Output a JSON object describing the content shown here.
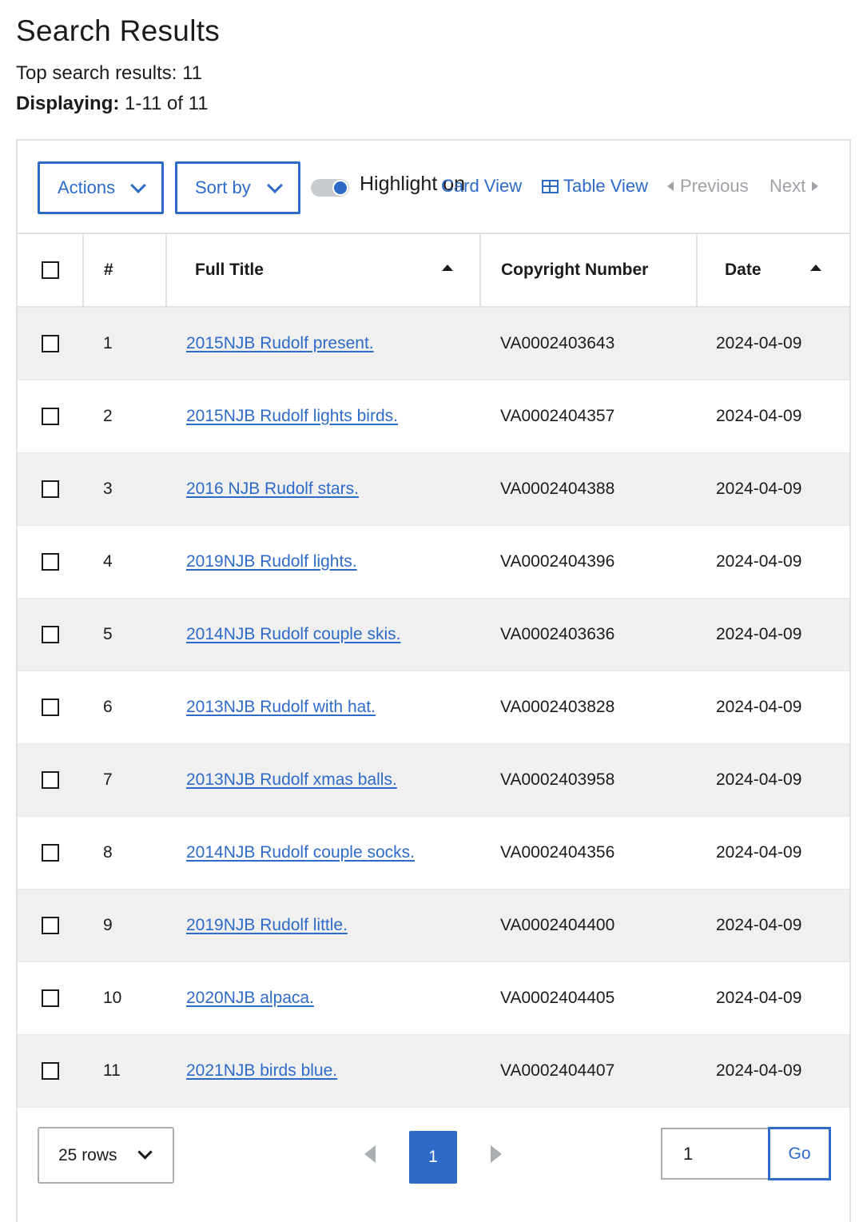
{
  "header": {
    "title": "Search Results",
    "top_results_label": "Top search results: 11",
    "displaying_label": "Displaying:",
    "displaying_value": "1-11 of 11"
  },
  "toolbar": {
    "actions_label": "Actions",
    "sort_label": "Sort by",
    "highlight_label": "Highlight on",
    "card_view_label": "Card View",
    "table_view_label": "Table View",
    "previous_label": "Previous",
    "next_label": "Next"
  },
  "table": {
    "headers": {
      "num": "#",
      "title": "Full Title",
      "copyright": "Copyright Number",
      "date": "Date"
    },
    "rows": [
      {
        "num": "1",
        "title": "2015NJB Rudolf present.",
        "copyright": "VA0002403643",
        "date": "2024-04-09"
      },
      {
        "num": "2",
        "title": "2015NJB Rudolf lights birds.",
        "copyright": "VA0002404357",
        "date": "2024-04-09"
      },
      {
        "num": "3",
        "title": "2016 NJB Rudolf stars.",
        "copyright": "VA0002404388",
        "date": "2024-04-09"
      },
      {
        "num": "4",
        "title": "2019NJB Rudolf lights.",
        "copyright": "VA0002404396",
        "date": "2024-04-09"
      },
      {
        "num": "5",
        "title": "2014NJB Rudolf couple skis.",
        "copyright": "VA0002403636",
        "date": "2024-04-09"
      },
      {
        "num": "6",
        "title": "2013NJB Rudolf with hat.",
        "copyright": "VA0002403828",
        "date": "2024-04-09"
      },
      {
        "num": "7",
        "title": "2013NJB Rudolf xmas balls.",
        "copyright": "VA0002403958",
        "date": "2024-04-09"
      },
      {
        "num": "8",
        "title": "2014NJB Rudolf couple socks.",
        "copyright": "VA0002404356",
        "date": "2024-04-09"
      },
      {
        "num": "9",
        "title": "2019NJB Rudolf little.",
        "copyright": "VA0002404400",
        "date": "2024-04-09"
      },
      {
        "num": "10",
        "title": "2020NJB alpaca.",
        "copyright": "VA0002404405",
        "date": "2024-04-09"
      },
      {
        "num": "11",
        "title": "2021NJB birds blue.",
        "copyright": "VA0002404407",
        "date": "2024-04-09"
      }
    ]
  },
  "footer": {
    "rows_per_page": "25 rows",
    "current_page": "1",
    "page_input_value": "1",
    "go_label": "Go"
  },
  "colors": {
    "accent": "#2e6bc9",
    "row_stripe": "#f0f0f0",
    "border": "#dfe1e2",
    "disabled": "#9ea2a6"
  }
}
